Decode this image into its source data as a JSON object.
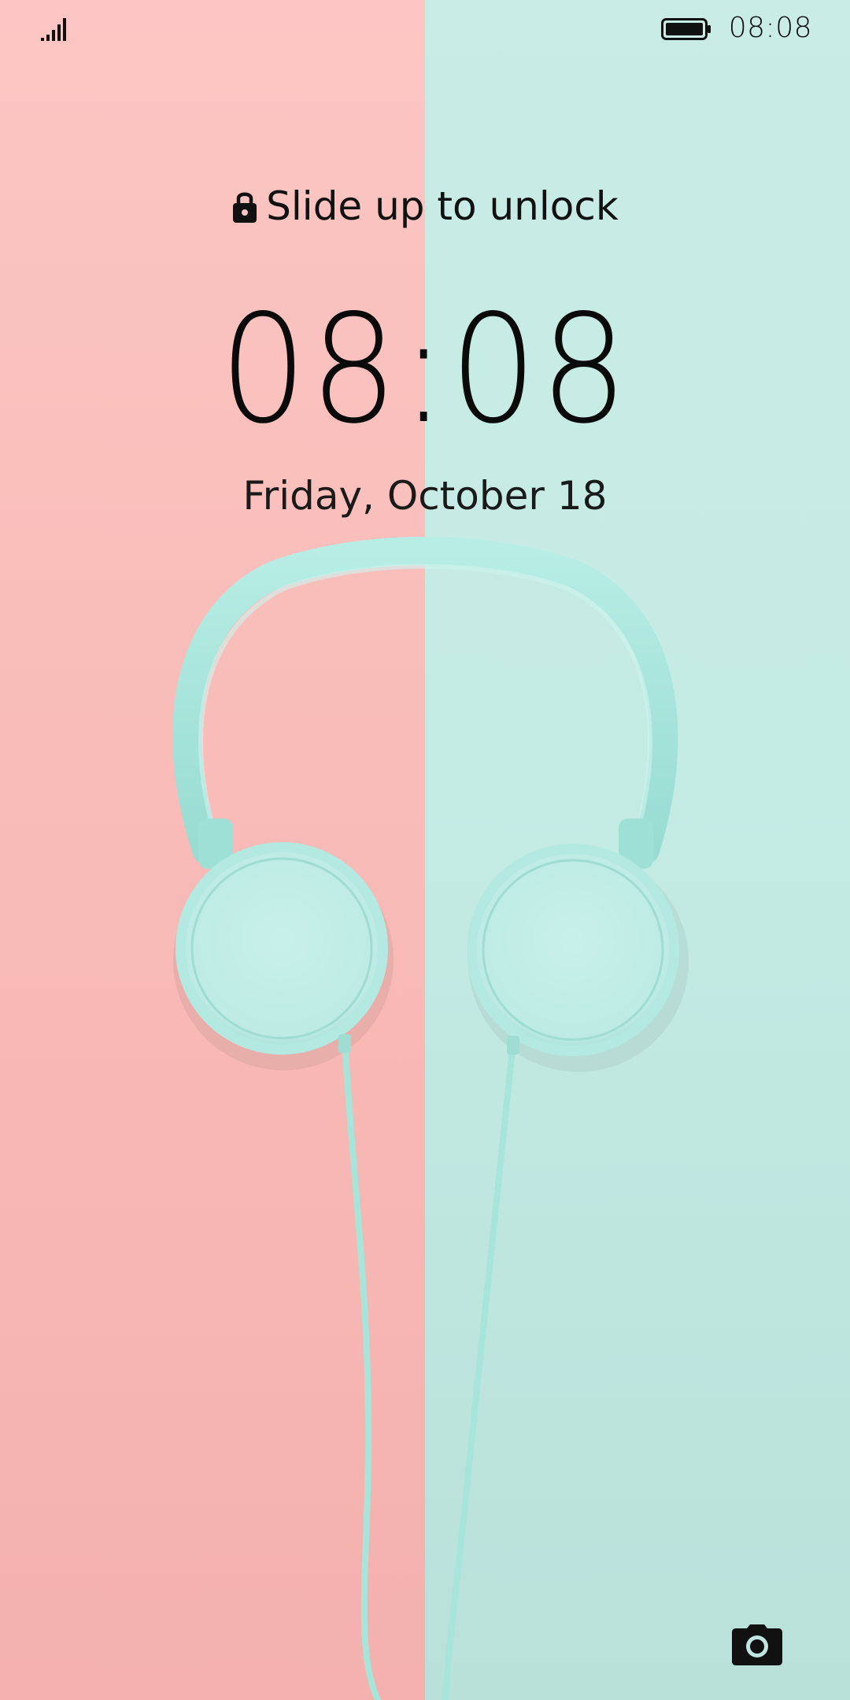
{
  "status_bar": {
    "time": "08:08",
    "signal_icon": "signal-bars-icon",
    "battery_icon": "battery-full-icon"
  },
  "lockscreen": {
    "unlock_hint": "Slide up to unlock",
    "lock_icon": "lock-icon",
    "clock": "08:08",
    "date": "Friday, October 18",
    "camera_icon": "camera-icon"
  },
  "wallpaper": {
    "left_color": "#f9bcb8",
    "right_color": "#c4ebe4",
    "headphone_color": "#a9e6dc"
  }
}
